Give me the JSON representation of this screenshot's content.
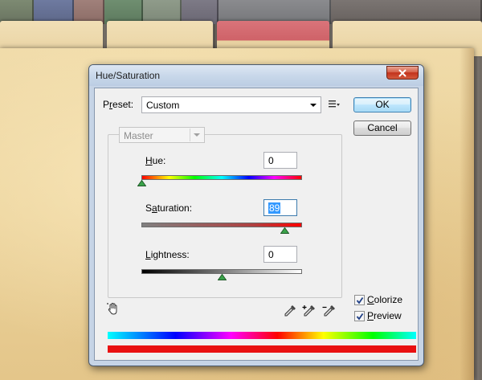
{
  "dialog": {
    "title": "Hue/Saturation",
    "close_icon": "close-x-icon"
  },
  "preset": {
    "label": "Preset:",
    "value": "Custom",
    "menu_icon": "preset-options-icon"
  },
  "buttons": {
    "ok": "OK",
    "cancel": "Cancel"
  },
  "channel": {
    "value": "Master"
  },
  "adjustments": {
    "hue": {
      "label": "Hue:",
      "value": "0",
      "level": 0.0
    },
    "saturation": {
      "label": "Saturation:",
      "value": "89",
      "level": 0.89
    },
    "lightness": {
      "label": "Lightness:",
      "value": "0",
      "level": 0.5
    }
  },
  "tools": {
    "hand": "targeted-adjustment-hand-icon",
    "eyedropper": "eyedropper-icon",
    "eyedropper_add": "eyedropper-plus-icon",
    "eyedropper_subtract": "eyedropper-minus-icon"
  },
  "options": {
    "colorize": {
      "label": "Colorize",
      "checked": true
    },
    "preview": {
      "label": "Preview",
      "checked": true
    }
  },
  "colors": {
    "titlebar": "#c6d4e6",
    "close_button": "#c2321c",
    "result_bar": "#e91111",
    "selection": "#3399ff"
  }
}
